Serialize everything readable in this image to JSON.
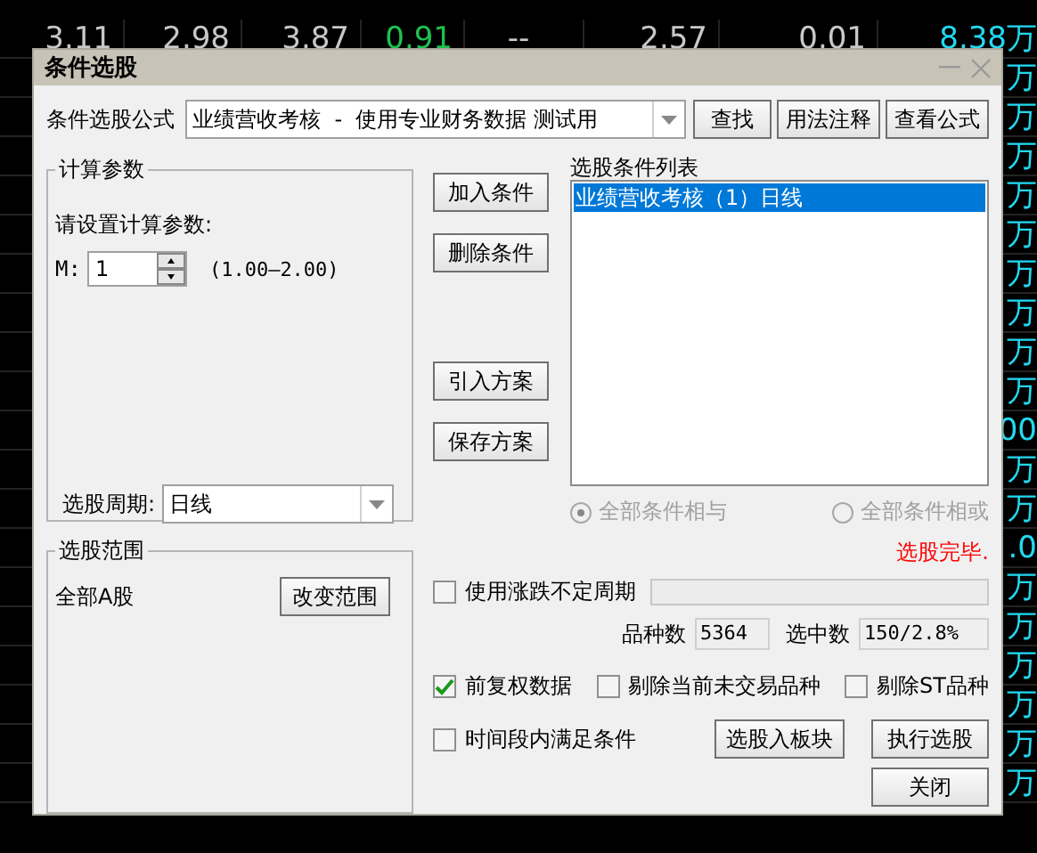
{
  "quote_table": {
    "top_row": [
      "3.11",
      "2.98",
      "3.87",
      "0.91",
      "--",
      "2.57",
      "0.01",
      "8.38万"
    ],
    "side_cells": [
      "万",
      "万",
      "万",
      "万",
      "万",
      "万",
      "万",
      "万",
      "万",
      "00",
      "万",
      "万",
      ".0",
      "万",
      "万",
      "万",
      "万",
      "万",
      "万"
    ]
  },
  "dialog": {
    "title": "条件选股",
    "formula": {
      "label": "条件选股公式",
      "value": "业绩营收考核  -  使用专业财务数据 测试用",
      "buttons": [
        "查找",
        "用法注释",
        "查看公式"
      ]
    },
    "params": {
      "title": "计算参数",
      "prompt": "请设置计算参数:",
      "param_label": "M:",
      "param_value": "1",
      "range": "(1.00—2.00)",
      "period_label": "选股周期:",
      "period_value": "日线"
    },
    "scope": {
      "title": "选股范围",
      "value": "全部A股",
      "button": "改变范围"
    },
    "condition_buttons": [
      "加入条件",
      "删除条件",
      "引入方案",
      "保存方案"
    ],
    "condition_list": {
      "title": "选股条件列表",
      "items": [
        {
          "text": "业绩营收考核（1）日线",
          "selected": true
        }
      ]
    },
    "logic": [
      {
        "label": "全部条件相与",
        "selected": true,
        "disabled": true
      },
      {
        "label": "全部条件相或",
        "selected": false,
        "disabled": true
      }
    ],
    "status": "选股完毕.",
    "variable_period": {
      "label": "使用涨跌不定周期",
      "checked": false
    },
    "progress": {
      "level": 0
    },
    "counts": [
      {
        "label": "品种数",
        "value": "5364"
      },
      {
        "label": "选中数",
        "value": "150/2.8%"
      }
    ],
    "options": [
      {
        "label": "前复权数据",
        "checked": true
      },
      {
        "label": "剔除当前未交易品种",
        "checked": false
      },
      {
        "label": "剔除ST品种",
        "checked": false
      },
      {
        "label": "时间段内满足条件",
        "checked": false
      }
    ],
    "action_buttons": [
      "选股入板块",
      "执行选股",
      "关闭"
    ]
  }
}
